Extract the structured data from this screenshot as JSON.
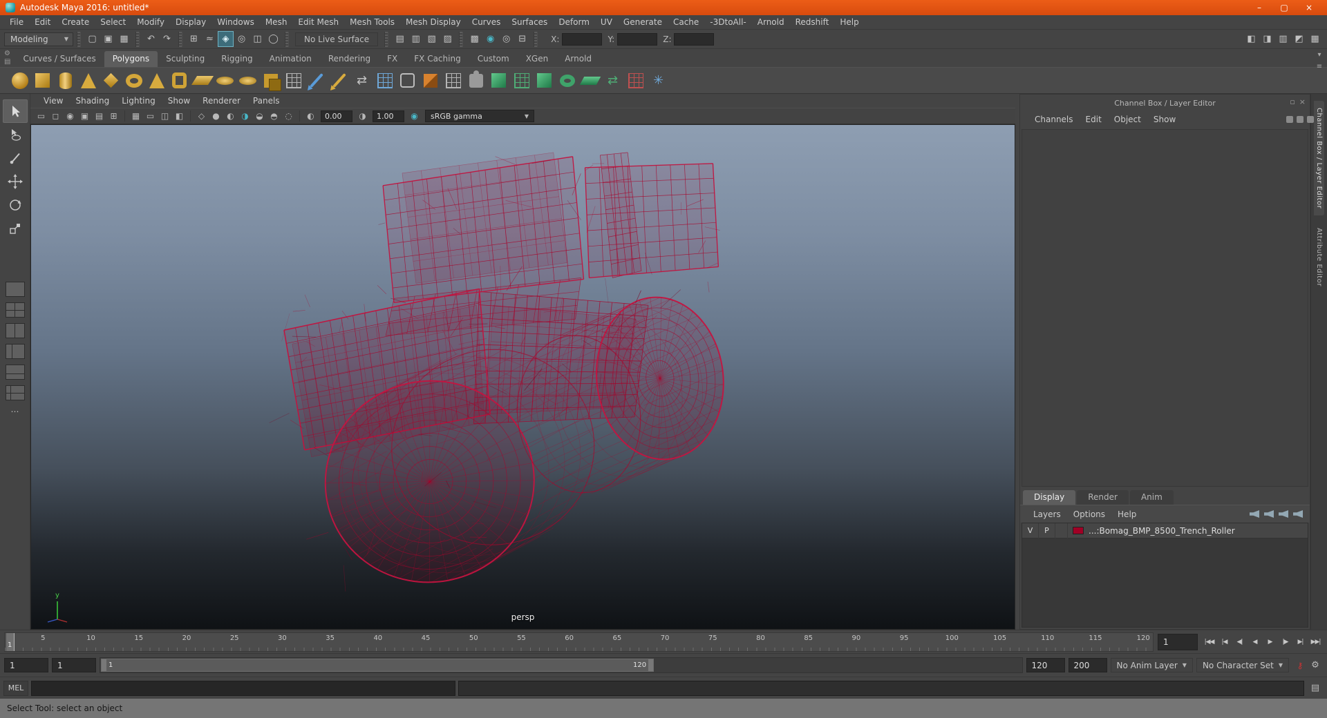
{
  "colors": {
    "accent_orange": "#e2541a",
    "wireframe_red": "#a8052c",
    "wireframe_red_bright": "#c41440",
    "ui_bg": "#444444",
    "highlight_teal": "#49b8c8",
    "layer_swatch": "#a00025"
  },
  "title_bar": {
    "title": "Autodesk Maya 2016: untitled*",
    "controls": [
      {
        "name": "minimize-button",
        "glyph": "–"
      },
      {
        "name": "maximize-button",
        "glyph": "▢"
      },
      {
        "name": "close-button",
        "glyph": "×"
      }
    ]
  },
  "menu_bar": {
    "items": [
      "File",
      "Edit",
      "Create",
      "Select",
      "Modify",
      "Display",
      "Windows",
      "Mesh",
      "Edit Mesh",
      "Mesh Tools",
      "Mesh Display",
      "Curves",
      "Surfaces",
      "Deform",
      "UV",
      "Generate",
      "Cache",
      "-3DtoAll-",
      "Arnold",
      "Redshift",
      "Help"
    ]
  },
  "status_line": {
    "menuset": "Modeling",
    "groups_left": [
      {
        "name": "file-group",
        "icons": [
          {
            "name": "new-scene-icon",
            "glyph": "▢"
          },
          {
            "name": "open-scene-icon",
            "glyph": "▣"
          },
          {
            "name": "save-scene-icon",
            "glyph": "▦"
          }
        ]
      },
      {
        "name": "undo-group",
        "icons": [
          {
            "name": "undo-icon",
            "glyph": "↶"
          },
          {
            "name": "redo-icon",
            "glyph": "↷"
          }
        ]
      },
      {
        "name": "snap-group",
        "icons": [
          {
            "name": "snap-to-grids-icon",
            "glyph": "⊞"
          },
          {
            "name": "snap-to-curves-icon",
            "glyph": "≈"
          },
          {
            "name": "snap-to-points-icon",
            "glyph": "◈",
            "active": true
          },
          {
            "name": "snap-to-projected-center-icon",
            "glyph": "◎"
          },
          {
            "name": "snap-to-view-planes-icon",
            "glyph": "◫"
          },
          {
            "name": "make-live-icon",
            "glyph": "◯"
          }
        ]
      }
    ],
    "live_surface": "No Live Surface",
    "groups_mid": [
      {
        "name": "history-group",
        "icons": [
          {
            "name": "list-input-operations-icon",
            "glyph": "▤"
          },
          {
            "name": "list-output-operations-icon",
            "glyph": "▥"
          },
          {
            "name": "construction-history-icon",
            "glyph": "▧"
          },
          {
            "name": "highlight-selection-icon",
            "glyph": "▨"
          }
        ]
      },
      {
        "name": "render-group",
        "icons": [
          {
            "name": "open-render-view-icon",
            "glyph": "▩"
          },
          {
            "name": "render-current-frame-icon",
            "glyph": "◉",
            "teal": true
          },
          {
            "name": "ipr-render-icon",
            "glyph": "◎"
          },
          {
            "name": "render-settings-icon",
            "glyph": "⊟"
          }
        ]
      }
    ],
    "coords": {
      "x_label": "X:",
      "y_label": "Y:",
      "z_label": "Z:"
    },
    "right_icons": [
      {
        "name": "show-modeling-toolkit-icon",
        "glyph": "◧"
      },
      {
        "name": "show-hypershade-icon",
        "glyph": "◨"
      },
      {
        "name": "show-attribute-editor-icon",
        "glyph": "▥"
      },
      {
        "name": "show-tool-settings-icon",
        "glyph": "◩"
      },
      {
        "name": "show-channel-box-icon",
        "glyph": "▦"
      }
    ]
  },
  "shelf": {
    "tabs": [
      "Curves / Surfaces",
      "Polygons",
      "Sculpting",
      "Rigging",
      "Animation",
      "Rendering",
      "FX",
      "FX Caching",
      "Custom",
      "XGen",
      "Arnold"
    ],
    "active_tab": "Polygons",
    "mini_icons": [
      {
        "name": "shelf-gear-icon",
        "glyph": "⚙"
      },
      {
        "name": "shelf-tab-list-icon",
        "glyph": "▤"
      }
    ],
    "side_buttons": [
      {
        "name": "shelf-menu-icon",
        "glyph": "▾"
      },
      {
        "name": "shelf-list-icon",
        "glyph": "≡"
      }
    ],
    "icons": [
      {
        "name": "poly-sphere-icon",
        "cls": "sp-sphere"
      },
      {
        "name": "poly-cube-icon",
        "cls": "sp-cube"
      },
      {
        "name": "poly-cylinder-icon",
        "cls": "sp-cyl"
      },
      {
        "name": "poly-cone-icon",
        "cls": "sp-cone"
      },
      {
        "name": "poly-platonic-icon",
        "cls": "sp-diamond"
      },
      {
        "name": "poly-torus-icon",
        "cls": "sp-torus"
      },
      {
        "name": "poly-pyramid-icon",
        "cls": "sp-cone"
      },
      {
        "name": "poly-pipe-icon",
        "cls": "sp-pipe"
      },
      {
        "name": "poly-plane-icon",
        "cls": "sp-plane"
      },
      {
        "name": "poly-disc-icon",
        "cls": "sp-disc"
      },
      {
        "name": "poly-gear-icon",
        "cls": "sp-disc"
      },
      {
        "name": "mesh-combine-icon",
        "cls": "sp-combine"
      },
      {
        "name": "mesh-separate-icon",
        "cls": "sp-grid-gray"
      },
      {
        "name": "multi-cut-icon",
        "cls": "sp-pencil-blue"
      },
      {
        "name": "crease-tool-icon",
        "cls": "sp-pencil-gold"
      },
      {
        "name": "target-weld-icon",
        "glyph": "⇄",
        "cls": "g-gray"
      },
      {
        "name": "quad-draw-icon",
        "cls": "sp-grid-blue"
      },
      {
        "name": "mesh-smooth-icon",
        "cls": "sp-frame"
      },
      {
        "name": "mirror-icon",
        "cls": "sp-fold-orange"
      },
      {
        "name": "poke-icon",
        "cls": "sp-grid-gray"
      },
      {
        "name": "assign-material-icon",
        "cls": "sp-puzzle"
      },
      {
        "name": "bevel-icon",
        "cls": "sp-cube-green"
      },
      {
        "name": "bridge-icon",
        "cls": "sp-grid-green"
      },
      {
        "name": "extrude-icon",
        "cls": "sp-cube-green"
      },
      {
        "name": "merge-vertices-icon",
        "cls": "sp-torus-green"
      },
      {
        "name": "wedge-icon",
        "cls": "sp-slab-green"
      },
      {
        "name": "spin-edge-icon",
        "glyph": "⇄",
        "cls": "g-green"
      },
      {
        "name": "booleans-icon",
        "cls": "sp-grid-red"
      },
      {
        "name": "connect-icon",
        "glyph": "✳",
        "cls": "g-blue"
      }
    ]
  },
  "toolbox": {
    "tools": [
      {
        "name": "select-tool",
        "active": true
      },
      {
        "name": "lasso-tool"
      },
      {
        "name": "paint-select-tool"
      },
      {
        "name": "move-tool"
      },
      {
        "name": "rotate-tool"
      },
      {
        "name": "scale-tool"
      }
    ],
    "layouts": [
      {
        "name": "single-pane-layout",
        "cls": "lb"
      },
      {
        "name": "four-pane-layout",
        "cls": "lb lb-four"
      },
      {
        "name": "two-pane-side-layout",
        "cls": "lb lb-two"
      },
      {
        "name": "three-pane-left-layout",
        "cls": "lb lb-left"
      },
      {
        "name": "pane-bottom-layout",
        "cls": "lb lb-bottom"
      },
      {
        "name": "outliner-persp-layout",
        "cls": "lb lb-outl"
      },
      {
        "name": "more-layouts",
        "cls": "lb lb-more",
        "glyph": "…"
      }
    ]
  },
  "viewport": {
    "menus": [
      "View",
      "Shading",
      "Lighting",
      "Show",
      "Renderer",
      "Panels"
    ],
    "toolbar_icons": [
      {
        "name": "select-camera-icon",
        "glyph": "▭"
      },
      {
        "name": "lock-camera-icon",
        "glyph": "◻"
      },
      {
        "name": "camera-attributes-icon",
        "glyph": "◉"
      },
      {
        "name": "bookmarks-icon",
        "glyph": "▣"
      },
      {
        "name": "image-plane-icon",
        "glyph": "▤"
      },
      {
        "name": "2d-pan-zoom-icon",
        "glyph": "⊞"
      },
      {
        "name": "grid-toggle-icon",
        "glyph": "▦"
      },
      {
        "name": "film-gate-icon",
        "glyph": "▭"
      },
      {
        "name": "resolution-gate-icon",
        "glyph": "◫"
      },
      {
        "name": "gate-mask-icon",
        "glyph": "◧"
      },
      {
        "name": "wireframe-mode-icon",
        "glyph": "◇"
      },
      {
        "name": "shaded-mode-icon",
        "glyph": "●"
      },
      {
        "name": "textured-mode-icon",
        "glyph": "◐"
      },
      {
        "name": "use-all-lights-icon",
        "glyph": "◑",
        "teal": true
      },
      {
        "name": "shadows-icon",
        "glyph": "◒"
      },
      {
        "name": "occlusion-icon",
        "glyph": "◓"
      },
      {
        "name": "motion-blur-icon",
        "glyph": "◌"
      }
    ],
    "exposure_icon": "◐",
    "exposure": "0.00",
    "gamma_icon": "◑",
    "gamma": "1.00",
    "transform_toggle_icon": "◉",
    "color_transform": "sRGB gamma",
    "camera": "persp"
  },
  "channel_box": {
    "header": "Channel Box / Layer Editor",
    "header_icons": [
      {
        "name": "pin-panel-icon",
        "glyph": "▫"
      },
      {
        "name": "close-panel-icon",
        "glyph": "×"
      }
    ],
    "menus": [
      "Channels",
      "Edit",
      "Object",
      "Show"
    ]
  },
  "layer_editor": {
    "tabs": [
      "Display",
      "Render",
      "Anim"
    ],
    "active_tab": "Display",
    "menus": [
      "Layers",
      "Options",
      "Help"
    ],
    "icon_buttons": [
      "move-layer-up-icon",
      "move-layer-down-icon",
      "create-empty-layer-icon",
      "create-layer-from-selected-icon"
    ],
    "layers": [
      {
        "visibility": "V",
        "playback": "P",
        "color": "#a00025",
        "name": "...:Bomag_BMP_8500_Trench_Roller"
      }
    ]
  },
  "side_panel_tabs": [
    {
      "label": "Channel Box / Layer Editor",
      "active": true
    },
    {
      "label": "Attribute Editor",
      "active": false
    }
  ],
  "timeline": {
    "min": 1,
    "max": 121,
    "tick_labels": [
      5,
      10,
      15,
      20,
      25,
      30,
      35,
      40,
      45,
      50,
      55,
      60,
      65,
      70,
      75,
      80,
      85,
      90,
      95,
      100,
      105,
      110,
      115,
      120
    ],
    "current_frame": "1",
    "current_frame_field": "1",
    "playback_buttons": [
      {
        "name": "go-to-start-button",
        "glyph": "|◀◀"
      },
      {
        "name": "step-back-key-button",
        "glyph": "|◀"
      },
      {
        "name": "step-back-frame-button",
        "glyph": "◀|"
      },
      {
        "name": "play-backwards-button",
        "glyph": "◀"
      },
      {
        "name": "play-forwards-button",
        "glyph": "▶"
      },
      {
        "name": "step-forward-frame-button",
        "glyph": "|▶"
      },
      {
        "name": "step-forward-key-button",
        "glyph": "▶|"
      },
      {
        "name": "go-to-end-button",
        "glyph": "▶▶|"
      }
    ]
  },
  "range_slider": {
    "animation_start": "1",
    "playback_start": "1",
    "bar_start_label": "1",
    "bar_end_label": "120",
    "playback_end": "120",
    "animation_end": "200",
    "range_fraction": 0.6,
    "anim_layer_label": "No Anim Layer",
    "character_set_label": "No Character Set",
    "icons": [
      {
        "name": "auto-keyframe-icon",
        "glyph": "⚷",
        "cls": "key-icon"
      },
      {
        "name": "animation-preferences-icon",
        "glyph": "⚙",
        "cls": ""
      }
    ]
  },
  "command_line": {
    "label": "MEL"
  },
  "help_line": {
    "text": "Select Tool: select an object"
  }
}
